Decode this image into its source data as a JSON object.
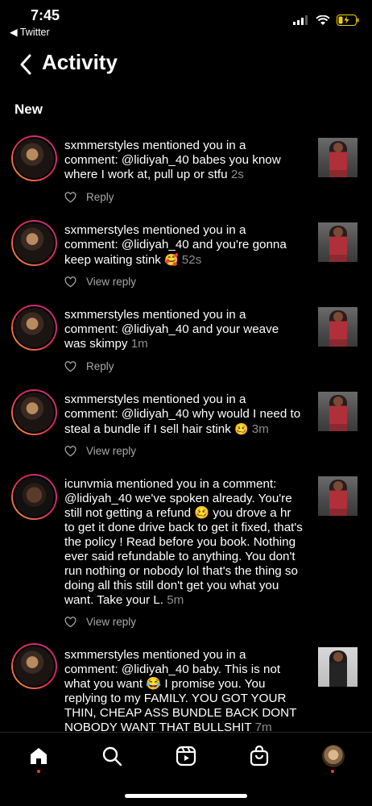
{
  "status_bar": {
    "time": "7:45",
    "back_app": "◀ Twitter"
  },
  "header": {
    "title": "Activity"
  },
  "section": "New",
  "activity": [
    {
      "user": "sxmmerstyles",
      "message": " mentioned you in a comment: @lidiyah_40 babes you know where I work at, pull up or stfu",
      "emoji": "",
      "time": "2s",
      "action": "Reply"
    },
    {
      "user": "sxmmerstyles",
      "message": " mentioned you in a comment: @lidiyah_40 and you're gonna keep waiting stink",
      "emoji": "🥰",
      "time": "52s",
      "action": "View reply"
    },
    {
      "user": "sxmmerstyles",
      "message": " mentioned you in a comment: @lidiyah_40 and your weave was skimpy",
      "emoji": "",
      "time": "1m",
      "action": "Reply"
    },
    {
      "user": "sxmmerstyles",
      "message": " mentioned you in a comment: @lidiyah_40 why would I need to steal a bundle if I sell hair stink",
      "emoji": "🥴",
      "time": "3m",
      "action": "View reply"
    },
    {
      "user": "icunvmia",
      "message": " mentioned you in a comment: @lidiyah_40 we've spoken already. You're still not getting a refund 🥴 you drove a hr to get it done drive back to get it fixed, that's the policy ! Read before you book. Nothing ever said refundable to anything. You don't run nothing or nobody lol that's the thing so doing all this still don't get you what you want. Take your L.",
      "emoji": "",
      "time": "5m",
      "action": "View reply"
    },
    {
      "user": "sxmmerstyles",
      "message": " mentioned you in a comment: @lidiyah_40 baby. This is not what you want 😂 I promise you. You replying to my FAMILY. YOU GOT YOUR THIN, CHEAP ASS BUNDLE BACK DONT NOBODY WANT THAT BULLSHIT",
      "emoji": "",
      "time": "7m",
      "action": ""
    }
  ],
  "nav": {
    "icons": [
      "home-icon",
      "search-icon",
      "reels-icon",
      "shop-icon",
      "profile-avatar"
    ]
  }
}
